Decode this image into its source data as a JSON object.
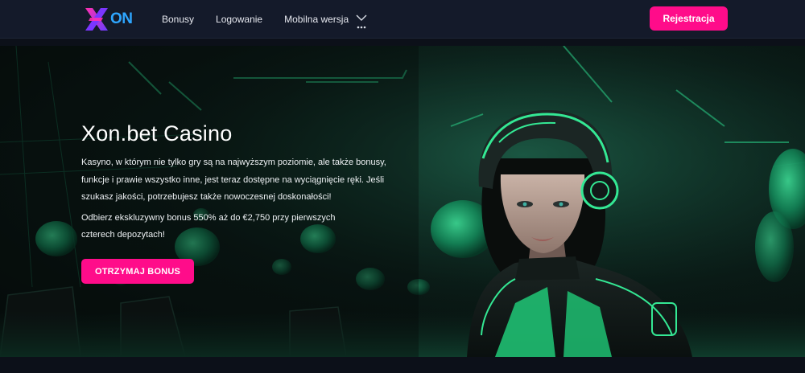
{
  "header": {
    "logo_icon": "xon-logo-icon",
    "logo_text": "ON",
    "nav": [
      {
        "label": "Bonusy"
      },
      {
        "label": "Logowanie"
      },
      {
        "label": "Mobilna wersja"
      }
    ],
    "more_icon": "chevron-down-dots-icon",
    "register_label": "Rejestracja"
  },
  "hero": {
    "title": "Xon.bet Casino",
    "description": "Kasyno, w którym nie tylko gry są na najwyższym poziomie, ale także bonusy, funkcje i prawie wszystko inne, jest teraz dostępne na wyciągnięcie ręki. Jeśli szukasz jakości, potrzebujesz także nowoczesnej doskonałości!",
    "offer": "Odbierz ekskluzywny bonus 550% aż do €2,750 przy pierwszych czterech depozytach!",
    "cta_label": "OTRZYMAJ BONUS",
    "image_icon": "cyber-woman-casino-illustration"
  },
  "colors": {
    "accent": "#ff0c8a",
    "header_bg": "#141a2a",
    "neon_green": "#21e58a",
    "logo_purple": "#8b3dff",
    "logo_blue": "#2aa8ff"
  }
}
